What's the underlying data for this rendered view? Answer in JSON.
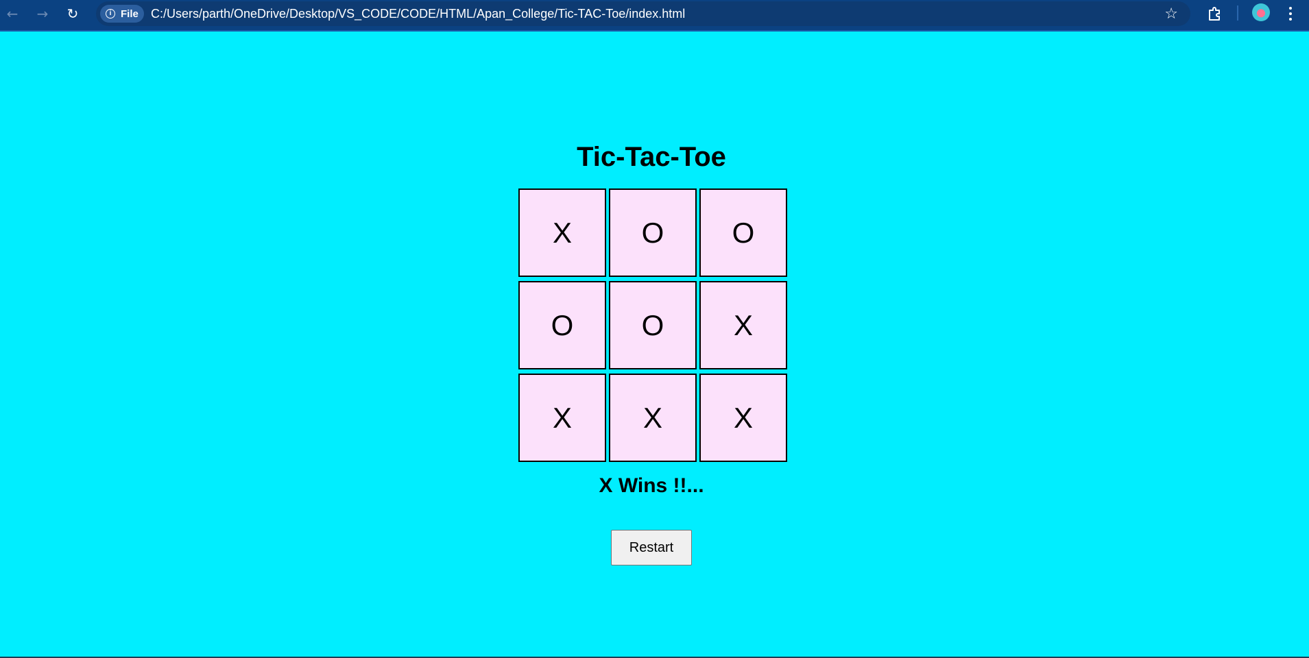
{
  "browser": {
    "back_icon": "back-arrow-icon",
    "forward_icon": "forward-arrow-icon",
    "reload_icon": "reload-icon",
    "site_info_label": "File",
    "url": "C:/Users/parth/OneDrive/Desktop/VS_CODE/CODE/HTML/Apan_College/Tic-TAC-Toe/index.html",
    "bookmark_icon": "star-icon",
    "extensions_icon": "puzzle-icon",
    "profile_icon": "avatar",
    "menu_icon": "vertical-dots-icon"
  },
  "game": {
    "title": "Tic-Tac-Toe",
    "board": [
      [
        "X",
        "O",
        "O"
      ],
      [
        "O",
        "O",
        "X"
      ],
      [
        "X",
        "X",
        "X"
      ]
    ],
    "message": "X Wins !!...",
    "restart_label": "Restart"
  },
  "colors": {
    "page_background": "#00eeff",
    "cell_background": "#fce1fb",
    "toolbar": "#0b4282"
  }
}
